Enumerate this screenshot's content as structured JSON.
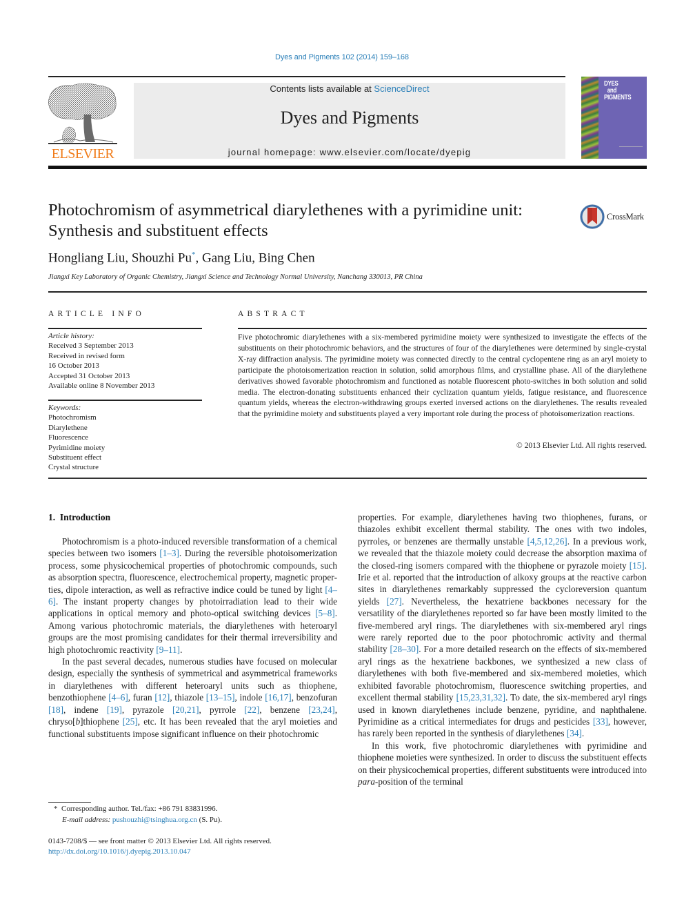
{
  "header": {
    "citation": "Dyes and Pigments 102 (2014) 159–168",
    "contents_prefix": "Contents lists available at ",
    "contents_link": "ScienceDirect",
    "journal_name": "Dyes and Pigments",
    "homepage": "journal homepage: www.elsevier.com/locate/dyepig",
    "publisher_wordmark": "ELSEVIER",
    "cover_title_lines": [
      "DYES",
      "and",
      "PIGMENTS"
    ],
    "colors": {
      "link": "#2a7fb8",
      "elsevier_orange": "#f07c1a",
      "cover_purple": "#6e64b4"
    }
  },
  "article": {
    "title": "Photochromism of asymmetrical diarylethenes with a pyrimidine unit: Synthesis and substituent effects",
    "crossmark_label": "CrossMark",
    "authors": [
      {
        "name": "Hongliang Liu",
        "corresponding": false
      },
      {
        "name": "Shouzhi Pu",
        "corresponding": true
      },
      {
        "name": "Gang Liu",
        "corresponding": false
      },
      {
        "name": "Bing Chen",
        "corresponding": false
      }
    ],
    "author_separator": ", ",
    "corresponding_mark": "*",
    "affiliation": "Jiangxi Key Laboratory of Organic Chemistry, Jiangxi Science and Technology Normal University, Nanchang 330013, PR China"
  },
  "article_info": {
    "heading": "ARTICLE INFO",
    "history_label": "Article history:",
    "history": [
      "Received 3 September 2013",
      "Received in revised form",
      "16 October 2013",
      "Accepted 31 October 2013",
      "Available online 8 November 2013"
    ],
    "keywords_label": "Keywords:",
    "keywords": [
      "Photochromism",
      "Diarylethene",
      "Fluorescence",
      "Pyrimidine moiety",
      "Substituent effect",
      "Crystal structure"
    ]
  },
  "abstract": {
    "heading": "ABSTRACT",
    "text": "Five photochromic diarylethenes with a six-membered pyrimidine moiety were synthesized to inves­tigate the effects of the substituents on their photochromic behaviors, and the structures of four of the diarylethenes were determined by single-crystal X-ray diffraction analysis. The pyrimidine moiety was connected directly to the central cyclopentene ring as an aryl moiety to participate the photo­isomerization reaction in solution, solid amorphous films, and crystalline phase. All of the diarylethene derivatives showed favorable photochromism and functioned as notable fluorescent photo-switches in both solution and solid media. The electron-donating substituents enhanced their cyclization quantum yields, fatigue resistance, and fluorescence quantum yields, whereas the electron-withdrawing groups exerted inversed actions on the diarylethenes. The results revealed that the pyrimidine moiety and substituents played a very important role during the process of photoisomerization reactions.",
    "copyright": "© 2013 Elsevier Ltd. All rights reserved."
  },
  "body": {
    "section_heading": "1.  Introduction",
    "paragraphs": [
      {
        "indent": true,
        "segments": [
          {
            "t": "Photochromism is a photo-induced reversible transformation of a chemical species between two isomers "
          },
          {
            "t": "[1–3]",
            "ref": true
          },
          {
            "t": ". During the reversible photoisomerization process, some physicochemical properties of photochromic compounds, such as absorption spectra, fluorescence, electrochemical property, magnetic proper­ties, dipole interaction, as well as refractive indice could be tuned by light "
          },
          {
            "t": "[4–6]",
            "ref": true
          },
          {
            "t": ". The instant property changes by photoirradiation lead to their wide applications in optical memory and photo-optical switching devices "
          },
          {
            "t": "[5–8]",
            "ref": true
          },
          {
            "t": ". Among various photochromic materials, the diarylethenes with heteroaryl groups are the most promising candidates for their thermal irreversibility and high photochromic reactivity "
          },
          {
            "t": "[9–11]",
            "ref": true
          },
          {
            "t": "."
          }
        ]
      },
      {
        "indent": true,
        "segments": [
          {
            "t": "In the past several decades, numerous studies have focused on molecular design, especially the synthesis of symmetrical and asymmetrical frameworks in diarylethenes with different hetero­aryl units such as thiophene, benzothiophene "
          },
          {
            "t": "[4–6]",
            "ref": true
          },
          {
            "t": ", furan "
          },
          {
            "t": "[12]",
            "ref": true
          },
          {
            "t": ", thiazole "
          },
          {
            "t": "[13–15]",
            "ref": true
          },
          {
            "t": ", indole "
          },
          {
            "t": "[16,17]",
            "ref": true
          },
          {
            "t": ", benzofuran "
          },
          {
            "t": "[18]",
            "ref": true
          },
          {
            "t": ", indene "
          },
          {
            "t": "[19]",
            "ref": true
          },
          {
            "t": ", pyr­azole "
          },
          {
            "t": "[20,21]",
            "ref": true
          },
          {
            "t": ", pyrrole "
          },
          {
            "t": "[22]",
            "ref": true
          },
          {
            "t": ", benzene "
          },
          {
            "t": "[23,24]",
            "ref": true
          },
          {
            "t": ", chryso["
          },
          {
            "t": "b",
            "italic": true
          },
          {
            "t": "]thiophene "
          },
          {
            "t": "[25]",
            "ref": true
          },
          {
            "t": ", etc. It has been revealed that the aryl moieties and functional substituents impose significant influence on their photochromic properties. For example, diarylethenes having two thiophenes, furans, or thiazoles exhibit excellent thermal stability. The ones with two indoles, pyrroles, or benzenes are thermally unstable "
          },
          {
            "t": "[4,5,12,26]",
            "ref": true
          },
          {
            "t": ". In a previous work, we revealed that the thiazole moiety could decrease the absorption maxima of the closed-ring isomers compared with the thiophene or pyrazole moiety "
          },
          {
            "t": "[15]",
            "ref": true
          },
          {
            "t": ". Irie et al. reported that the introduction of alkoxy groups at the reactive carbon sites in diarylethenes remarkably suppressed the cyclo­reversion quantum yields "
          },
          {
            "t": "[27]",
            "ref": true
          },
          {
            "t": ". Nevertheless, the hexatriene back­bones necessary for the versatility of the diarylethenes reported so far have been mostly limited to the five-membered aryl rings. The diarylethenes with six-membered aryl rings were rarely reported due to the poor photochromic activity and thermal stability "
          },
          {
            "t": "[28–30]",
            "ref": true
          },
          {
            "t": ". For a more detailed research on the effects of six-membered aryl rings as the hexatriene backbones, we synthesized a new class of diarylethenes with both five-membered and six-membered moieties, which exhibited favorable photochromism, fluorescence switching properties, and excellent thermal stability "
          },
          {
            "t": "[15,23,31,32]",
            "ref": true
          },
          {
            "t": ". To date, the six-membered aryl rings used in known diarylethenes include benzene, pyridine, and naphthalene. Pyrimidine as a critical intermediates for drugs and pesticides "
          },
          {
            "t": "[33]",
            "ref": true
          },
          {
            "t": ", however, has rarely been reported in the synthesis of diarylethenes "
          },
          {
            "t": "[34]",
            "ref": true
          },
          {
            "t": "."
          }
        ]
      },
      {
        "indent": true,
        "segments": [
          {
            "t": "In this work, five photochromic diarylethenes with pyrimidine and thiophene moieties were synthesized. In order to discuss the substituent effects on their physicochemical properties, different substituents were introduced into "
          },
          {
            "t": "para",
            "italic": true
          },
          {
            "t": "-position of the terminal"
          }
        ]
      }
    ]
  },
  "footnote": {
    "mark": "*",
    "text": "Corresponding author. Tel./fax: +86 791 83831996.",
    "email_label": "E-mail address:",
    "email": "pushouzhi@tsinghua.org.cn",
    "email_suffix": " (S. Pu)."
  },
  "front_matter": {
    "issn_line": "0143-7208/$ — see front matter © 2013 Elsevier Ltd. All rights reserved.",
    "doi": "http://dx.doi.org/10.1016/j.dyepig.2013.10.047"
  }
}
